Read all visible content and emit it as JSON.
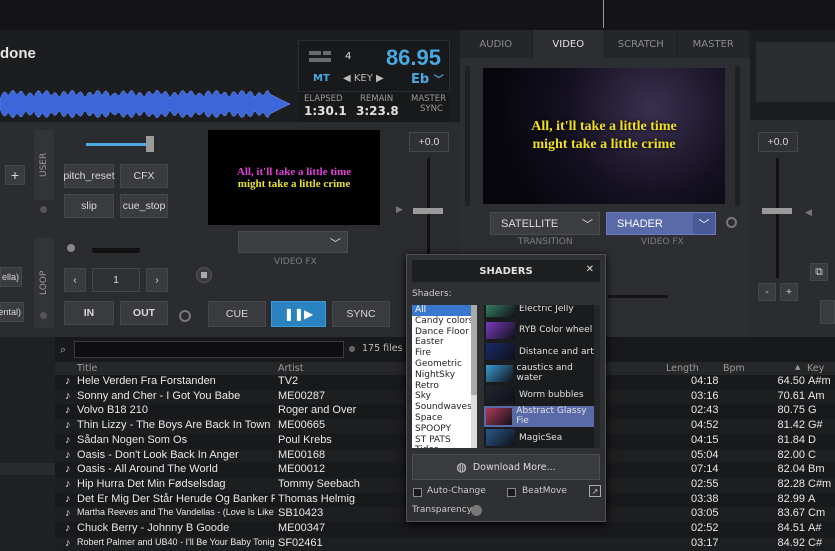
{
  "deck_left": {
    "title_fragment": "done",
    "pitch_number": "4",
    "bpm": "86.95",
    "mt_label": "MT",
    "key_label": "◀ KEY ▶",
    "key_value": "Eb",
    "elapsed_label": "ELAPSED",
    "elapsed_value": "1:30.1",
    "remain_label": "REMAIN",
    "remain_value": "3:23.8",
    "master_label": "MASTER",
    "sync_label": "SYNC",
    "plus_label": "+",
    "user_label": "USER",
    "loop_label": "LOOP",
    "pitch_reset_label": "pitch_reset",
    "cfx_label": "CFX",
    "slip_label": "slip",
    "cue_stop_label": "cue_stop",
    "loop_size": "1",
    "in_label": "IN",
    "out_label": "OUT",
    "cue_label": "CUE",
    "sync_btn_label": "SYNC",
    "pitch_value": "+0.0",
    "video_fx_label": "VIDEO FX",
    "fx_side_1": "ella)",
    "fx_side_2": "ental)"
  },
  "lyrics_line1": "All, it'll take a little time",
  "lyrics_line2": "might take a little crime",
  "center": {
    "tabs": [
      "AUDIO",
      "VIDEO",
      "SCRATCH",
      "MASTER"
    ],
    "active_tab": "VIDEO",
    "transition_value": "SATELLITE",
    "transition_label": "TRANSITION",
    "videofx_value": "SHADER",
    "videofx_label": "VIDEO FX"
  },
  "deck_right": {
    "pitch_value": "+0.0",
    "minus_label": "-",
    "plus_label": "+"
  },
  "shaders_panel": {
    "title": "SHADERS",
    "close": "✕",
    "list_label": "Shaders:",
    "categories": [
      "All",
      "Candy colors",
      "Dance Floor",
      "Easter",
      "Fire",
      "Geometric",
      "NightSky",
      "Retro",
      "Sky",
      "Soundwaves",
      "Space",
      "SPOOPY",
      "ST PATS",
      "Tides"
    ],
    "selected_category": "All",
    "items": [
      {
        "name": "Electric Jelly",
        "color": "#3a8c6a"
      },
      {
        "name": "RYB Color wheel",
        "color": "#7a3ac0"
      },
      {
        "name": "Distance and art",
        "color": "#1a2a6a"
      },
      {
        "name": "caustics and water",
        "color": "#3a9ad0"
      },
      {
        "name": "Worm bubbles",
        "color": "#202830"
      },
      {
        "name": "Abstract Glassy Fie",
        "color": "#b03a5a"
      },
      {
        "name": "MagicSea",
        "color": "#2a5a8a"
      }
    ],
    "selected_item": "Abstract Glassy Fie",
    "download_label": "Download More...",
    "auto_change_label": "Auto-Change",
    "beatmove_label": "BeatMove",
    "transparency_label": "Transparency"
  },
  "browser": {
    "file_count": "175 files",
    "columns": {
      "title": "Title",
      "artist": "Artist",
      "length": "Length",
      "bpm": "Bpm",
      "key": "Key"
    },
    "rows": [
      {
        "title": "Hele Verden Fra Forstanden",
        "artist": "TV2",
        "length": "04:18",
        "bpm": "64.50",
        "key": "A#m"
      },
      {
        "title": "Sonny and Cher - I Got You Babe",
        "artist": "ME00287",
        "length": "03:16",
        "bpm": "70.61",
        "key": "Am"
      },
      {
        "title": "Volvo B18 210",
        "artist": "Roger and Over",
        "length": "02:43",
        "bpm": "80.75",
        "key": "G"
      },
      {
        "title": "Thin Lizzy - The Boys Are Back In Town",
        "artist": "ME00665",
        "length": "04:52",
        "bpm": "81.42",
        "key": "G#"
      },
      {
        "title": "Sådan Nogen Som Os",
        "artist": "Poul Krebs",
        "length": "04:15",
        "bpm": "81.84",
        "key": "D"
      },
      {
        "title": "Oasis - Don't Look Back In Anger",
        "artist": "ME00168",
        "length": "05:04",
        "bpm": "82.00",
        "key": "C"
      },
      {
        "title": "Oasis - All Around The World",
        "artist": "ME00012",
        "length": "07:14",
        "bpm": "82.04",
        "key": "Bm"
      },
      {
        "title": "Hip Hurra Det Min Fødselsdag",
        "artist": "Tommy Seebach",
        "length": "02:55",
        "bpm": "82.28",
        "key": "C#m"
      },
      {
        "title": "Det Er Mig Der Står Herude Og Banker På",
        "artist": "Thomas Helmig",
        "length": "03:38",
        "bpm": "82.99",
        "key": "A"
      },
      {
        "title": "Martha Reeves and The Vandellas - (Love Is Like A) He...",
        "artist": "SB10423",
        "length": "03:05",
        "bpm": "83.67",
        "key": "Cm"
      },
      {
        "title": "Chuck Berry - Johnny B Goode",
        "artist": "ME00347",
        "length": "02:52",
        "bpm": "84.51",
        "key": "A#"
      },
      {
        "title": "Robert Palmer and UB40 - I'll Be Your Baby Tonight",
        "artist": "SF02461",
        "length": "03:17",
        "bpm": "84.92",
        "key": "C#"
      }
    ]
  }
}
